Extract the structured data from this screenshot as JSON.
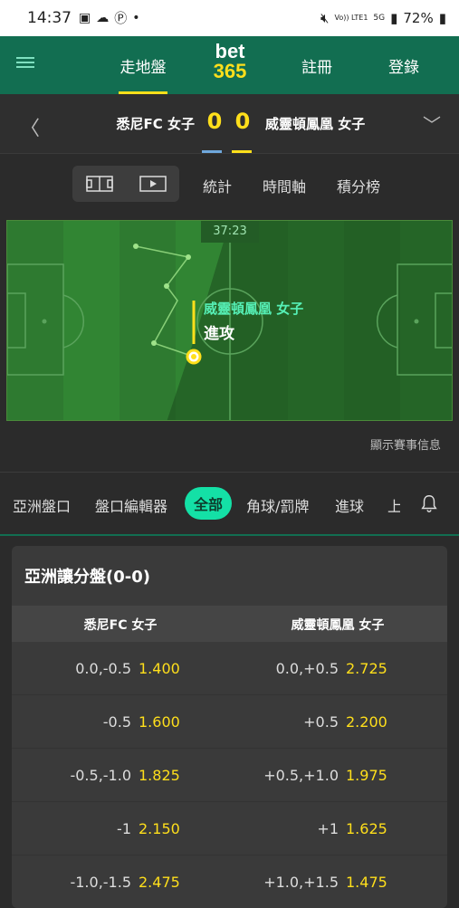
{
  "status": {
    "time": "14:37",
    "battery": "72%",
    "volte": "Vo)) LTE1",
    "network": "5G"
  },
  "nav": {
    "inplay": "走地盤",
    "register": "註冊",
    "login": "登錄",
    "logo_bet": "bet",
    "logo_365": "365"
  },
  "match": {
    "home": "悉尼FC 女子",
    "away": "威靈頓鳳凰 女子",
    "home_score": "0",
    "away_score": "0"
  },
  "view_tabs": [
    "統計",
    "時間軸",
    "積分榜"
  ],
  "pitch": {
    "clock": "37:23",
    "team": "威靈頓鳳凰 女子",
    "action": "進攻"
  },
  "show_info": "顯示賽事信息",
  "market_tabs": [
    "亞洲盤口",
    "盤口編輯器",
    "全部",
    "角球/罰牌",
    "進球",
    "上"
  ],
  "market": {
    "title": "亞洲讓分盤(0-0)",
    "col_home": "悉尼FC 女子",
    "col_away": "威靈頓鳳凰 女子",
    "rows": [
      {
        "h_line": "0.0,-0.5",
        "h_odds": "1.400",
        "a_line": "0.0,+0.5",
        "a_odds": "2.725"
      },
      {
        "h_line": "-0.5",
        "h_odds": "1.600",
        "a_line": "+0.5",
        "a_odds": "2.200"
      },
      {
        "h_line": "-0.5,-1.0",
        "h_odds": "1.825",
        "a_line": "+0.5,+1.0",
        "a_odds": "1.975"
      },
      {
        "h_line": "-1",
        "h_odds": "2.150",
        "a_line": "+1",
        "a_odds": "1.625"
      },
      {
        "h_line": "-1.0,-1.5",
        "h_odds": "2.475",
        "a_line": "+1.0,+1.5",
        "a_odds": "1.475"
      }
    ]
  },
  "colors": {
    "brand_green": "#126e51",
    "accent_yellow": "#ffdf1b",
    "active_pill": "#14e0a6",
    "home_bar": "#6fa8dc",
    "away_bar": "#ffdf1b"
  }
}
